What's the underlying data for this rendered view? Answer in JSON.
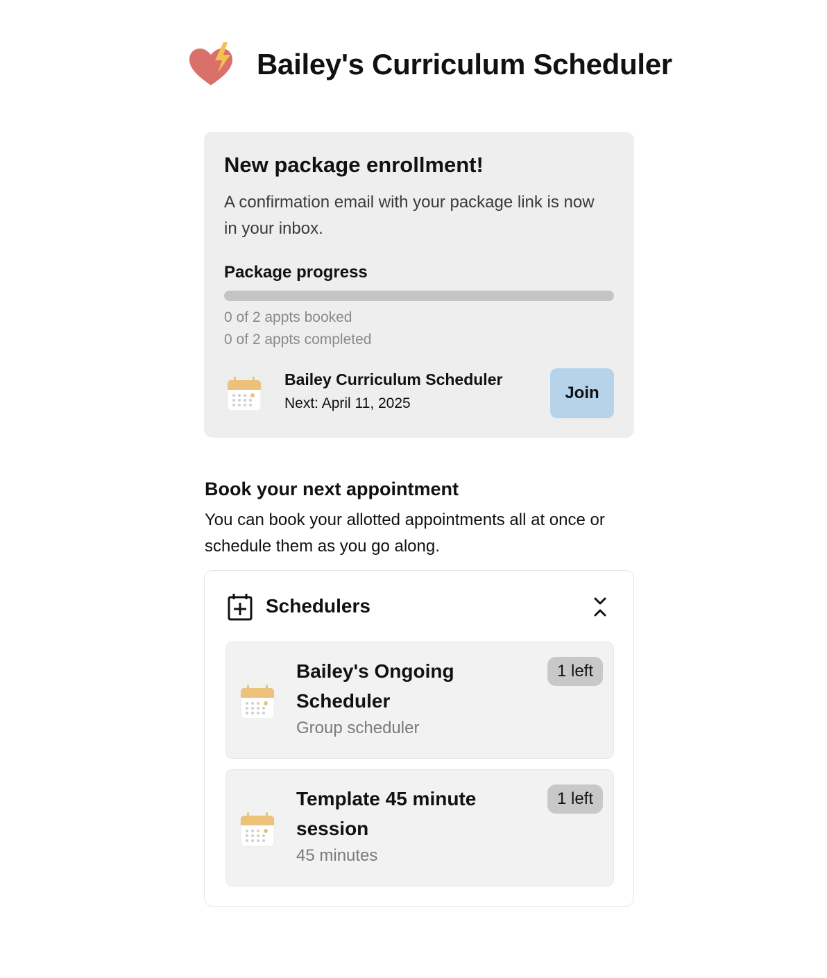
{
  "app": {
    "title": "Bailey's Curriculum Scheduler",
    "logo_icon": "heart-lightning-icon",
    "colors": {
      "logo_heart": "#d9706a",
      "logo_bolt": "#f2c14e",
      "accent": "#b5d3ea",
      "calendar": "#ecc27b"
    }
  },
  "enrollment": {
    "title": "New package enrollment!",
    "message": "A confirmation email with your package link is now in your inbox.",
    "progress_label": "Package progress",
    "progress_value": 0,
    "booked_text": "0 of 2 appts booked",
    "completed_text": "0 of 2 appts completed",
    "appointment": {
      "icon": "calendar-icon",
      "name": "Bailey Curriculum Scheduler",
      "next": "Next: April 11, 2025",
      "join_label": "Join"
    }
  },
  "booking": {
    "title": "Book your next appointment",
    "description": "You can book your allotted appointments all at once or schedule them as you go along."
  },
  "schedulers": {
    "title": "Schedulers",
    "header_icon": "calendar-plus-icon",
    "collapse_icon": "collapse-icon",
    "items": [
      {
        "title": "Bailey's Ongoing Scheduler",
        "subtitle": "Group scheduler",
        "badge": "1 left",
        "icon": "calendar-icon"
      },
      {
        "title": "Template 45 minute session",
        "subtitle": "45 minutes",
        "badge": "1 left",
        "icon": "calendar-icon"
      }
    ]
  }
}
